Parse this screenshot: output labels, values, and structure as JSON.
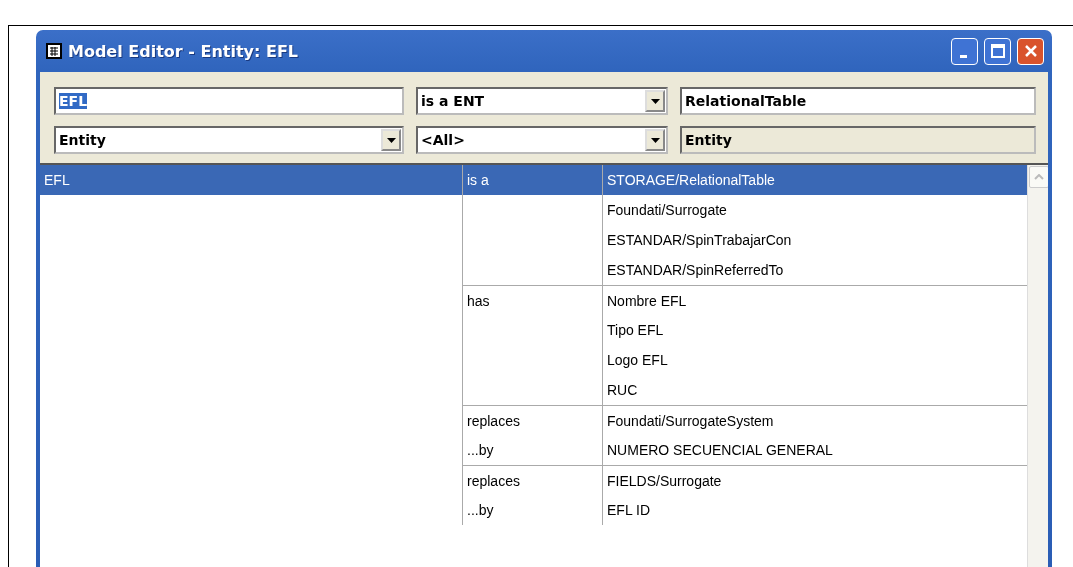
{
  "window": {
    "title": "Model Editor - Entity: EFL"
  },
  "fields": {
    "name": {
      "value": "EFL",
      "selected_text": true
    },
    "relation": {
      "value": "is a ENT"
    },
    "target": {
      "value": "RelationalTable"
    },
    "type": {
      "value": "Entity"
    },
    "filter": {
      "value": "<All>"
    },
    "kind_label": "Entity"
  },
  "table": {
    "entity": "EFL",
    "groups": [
      {
        "lines": [
          {
            "relation": "is a",
            "target": "STORAGE/RelationalTable",
            "selected": true
          },
          {
            "target": "Foundati/Surrogate",
            "selected": false
          },
          {
            "target": "ESTANDAR/SpinTrabajarCon",
            "selected": false
          },
          {
            "target": "ESTANDAR/SpinReferredTo",
            "selected": false
          }
        ]
      },
      {
        "lines": [
          {
            "relation": "has",
            "target": "Nombre EFL",
            "selected": false
          },
          {
            "target": "Tipo EFL",
            "selected": false
          },
          {
            "target": "Logo EFL",
            "selected": false
          },
          {
            "target": "RUC",
            "selected": false
          }
        ]
      },
      {
        "lines": [
          {
            "relation": "replaces",
            "target": "Foundati/SurrogateSystem",
            "selected": false
          },
          {
            "relation": "...by",
            "target": "NUMERO SECUENCIAL GENERAL",
            "selected": false
          }
        ]
      },
      {
        "lines": [
          {
            "relation": "replaces",
            "target": "FIELDS/Surrogate",
            "selected": false
          },
          {
            "relation": "...by",
            "target": "EFL ID",
            "selected": false
          }
        ]
      }
    ]
  }
}
